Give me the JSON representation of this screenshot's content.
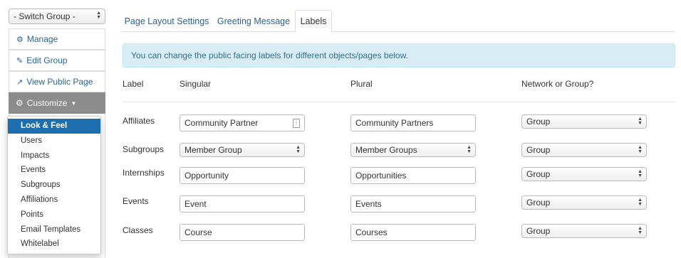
{
  "switch_group": {
    "value": "- Switch Group -"
  },
  "sidebar": {
    "manage": "Manage",
    "edit_group": "Edit Group",
    "view_public_page": "View Public Page",
    "customize": "Customize"
  },
  "customize_menu": {
    "items": [
      "Look & Feel",
      "Users",
      "Impacts",
      "Events",
      "Subgroups",
      "Affiliations",
      "Points",
      "Email Templates",
      "Whitelabel"
    ],
    "active_index": 0
  },
  "tabs": [
    "Page Layout Settings",
    "Greeting Message",
    "Labels"
  ],
  "active_tab": 2,
  "info_message": "You can change the public facing labels for different objects/pages below.",
  "table": {
    "headers": {
      "label": "Label",
      "singular": "Singular",
      "plural": "Plural",
      "scope": "Network or Group?"
    },
    "rows": [
      {
        "label": "Affiliates",
        "singular": "Community Partner",
        "plural": "Community Partners",
        "scope": "Group"
      },
      {
        "label": "Subgroups",
        "singular": "Member Group",
        "plural": "Member Groups",
        "scope": "Group"
      },
      {
        "label": "Internships",
        "singular": "Opportunity",
        "plural": "Opportunities",
        "scope": "Group"
      },
      {
        "label": "Events",
        "singular": "Event",
        "plural": "Events",
        "scope": "Group"
      },
      {
        "label": "Classes",
        "singular": "Course",
        "plural": "Courses",
        "scope": "Group"
      }
    ]
  },
  "colors": {
    "link": "#2a6496",
    "menu_active": "#1e6fb0",
    "customize_bg": "#8c8c8c",
    "info_bg": "#d9edf7"
  }
}
